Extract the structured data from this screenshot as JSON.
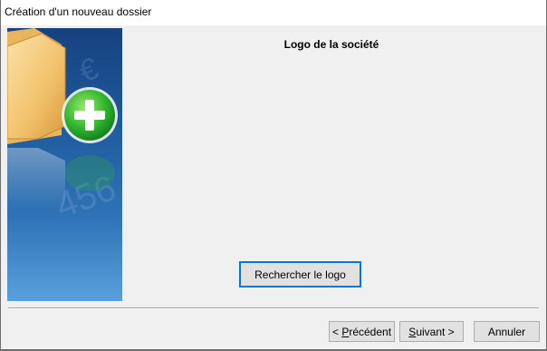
{
  "window": {
    "title": "Création d'un nouveau dossier"
  },
  "sidebar": {
    "image_icon": "folder-add-icon",
    "colors": {
      "top": "#16427f",
      "bottom": "#5aa0dc",
      "folder": "#f4c46a",
      "plus_circle": "#2fb52f"
    }
  },
  "main": {
    "heading": "Logo de la société",
    "browse_button_label": "Rechercher le logo"
  },
  "footer": {
    "prev_prefix": "< ",
    "prev_underline": "P",
    "prev_rest": "récédent",
    "next_underline": "S",
    "next_rest": "uivant >",
    "cancel_label": "Annuler"
  },
  "colors": {
    "focus_border": "#0078d7",
    "button_face": "#e1e1e1",
    "dialog_bg": "#f0f0f0"
  }
}
